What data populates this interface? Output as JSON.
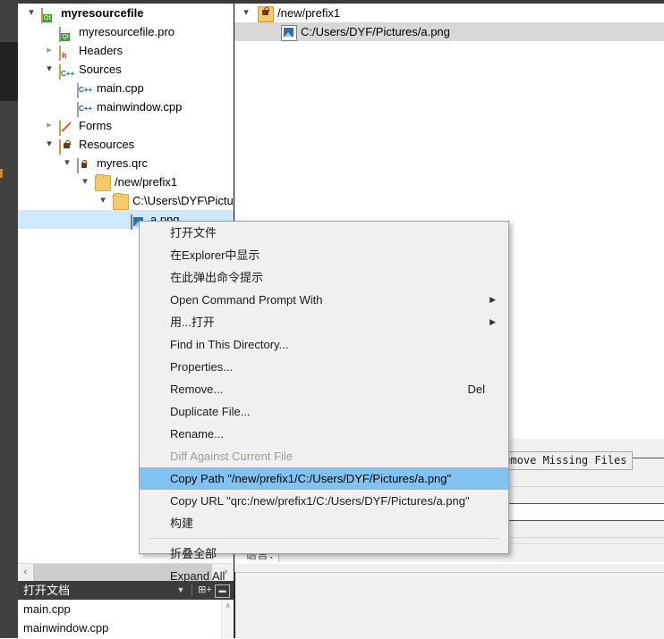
{
  "project_tree": {
    "panel_name": "project-tree",
    "rows": [
      {
        "depth": 0,
        "twisty": "open",
        "icon": "qt-project-icon",
        "icon_class": "ic-qtproj",
        "label": "myresourcefile",
        "bold": true,
        "selected": false
      },
      {
        "depth": 1,
        "twisty": "none",
        "icon": "qt-pro-file-icon",
        "icon_class": "ic-file",
        "label": "myresourcefile.pro",
        "bold": false,
        "selected": false
      },
      {
        "depth": 1,
        "twisty": "closed",
        "icon": "headers-folder-icon",
        "icon_class": "ic-hdr",
        "label": "Headers",
        "bold": false,
        "selected": false
      },
      {
        "depth": 1,
        "twisty": "open",
        "icon": "sources-folder-icon",
        "icon_class": "ic-src",
        "label": "Sources",
        "bold": false,
        "selected": false
      },
      {
        "depth": 2,
        "twisty": "none",
        "icon": "cpp-file-icon",
        "icon_class": "ic-cpp",
        "label": "main.cpp",
        "bold": false,
        "selected": false
      },
      {
        "depth": 2,
        "twisty": "none",
        "icon": "cpp-file-icon",
        "icon_class": "ic-cpp",
        "label": "mainwindow.cpp",
        "bold": false,
        "selected": false
      },
      {
        "depth": 1,
        "twisty": "closed",
        "icon": "forms-folder-icon",
        "icon_class": "ic-forms",
        "label": "Forms",
        "bold": false,
        "selected": false
      },
      {
        "depth": 1,
        "twisty": "open",
        "icon": "resources-folder-icon",
        "icon_class": "ic-res",
        "label": "Resources",
        "bold": false,
        "selected": false
      },
      {
        "depth": 2,
        "twisty": "open",
        "icon": "qrc-file-icon",
        "icon_class": "ic-qrc",
        "label": "myres.qrc",
        "bold": false,
        "selected": false
      },
      {
        "depth": 3,
        "twisty": "open",
        "icon": "folder-icon",
        "icon_class": "ic-folder",
        "label": "/new/prefix1",
        "bold": false,
        "selected": false
      },
      {
        "depth": 4,
        "twisty": "open",
        "icon": "folder-icon",
        "icon_class": "ic-folder",
        "label": "C:\\Users\\DYF\\Pictures",
        "bold": false,
        "selected": false
      },
      {
        "depth": 5,
        "twisty": "none",
        "icon": "png-image-icon",
        "icon_class": "ic-png",
        "label": "a.png",
        "bold": false,
        "selected": true
      }
    ]
  },
  "tree_scrollbar": {
    "left_arrow": "‹",
    "right_arrow": "›"
  },
  "open_documents": {
    "title": "打开文档",
    "caret_icon": "chevron-down-icon",
    "split_icon": "split-view-icon",
    "close_icon": "close-pane-icon",
    "items": [
      {
        "label": "main.cpp"
      },
      {
        "label": "mainwindow.cpp"
      }
    ],
    "scroll_up_arrow": "∧"
  },
  "qrc_editor": {
    "rows": [
      {
        "depth": 0,
        "twisty": "open",
        "icon": "qrc-prefix-icon",
        "label": "/new/prefix1",
        "selected": false
      },
      {
        "depth": 1,
        "twisty": "none",
        "icon": "png-image-icon",
        "label": "C:/Users/DYF/Pictures/a.png",
        "selected": true
      }
    ],
    "remove_missing_button": "Remove Missing Files",
    "language_label": "语言：",
    "language_value": ""
  },
  "context_menu": {
    "name": "file-context-menu",
    "items": [
      {
        "label": "打开文件",
        "accel": "",
        "submenu": false,
        "disabled": false,
        "highlighted": false,
        "separator": false,
        "name": "menu-item-open-file"
      },
      {
        "label": "在Explorer中显示",
        "accel": "",
        "submenu": false,
        "disabled": false,
        "highlighted": false,
        "separator": false,
        "name": "menu-item-show-in-explorer"
      },
      {
        "label": "在此弹出命令提示",
        "accel": "",
        "submenu": false,
        "disabled": false,
        "highlighted": false,
        "separator": false,
        "name": "menu-item-open-terminal-here"
      },
      {
        "label": "Open Command Prompt With",
        "accel": "",
        "submenu": true,
        "disabled": false,
        "highlighted": false,
        "separator": false,
        "name": "menu-item-open-command-prompt-with"
      },
      {
        "label": "用...打开",
        "accel": "",
        "submenu": true,
        "disabled": false,
        "highlighted": false,
        "separator": false,
        "name": "menu-item-open-with"
      },
      {
        "label": "Find in This Directory...",
        "accel": "",
        "submenu": false,
        "disabled": false,
        "highlighted": false,
        "separator": false,
        "name": "menu-item-find-in-this-directory"
      },
      {
        "label": "Properties...",
        "accel": "",
        "submenu": false,
        "disabled": false,
        "highlighted": false,
        "separator": false,
        "name": "menu-item-properties"
      },
      {
        "label": "Remove...",
        "accel": "Del",
        "submenu": false,
        "disabled": false,
        "highlighted": false,
        "separator": false,
        "name": "menu-item-remove"
      },
      {
        "label": "Duplicate File...",
        "accel": "",
        "submenu": false,
        "disabled": false,
        "highlighted": false,
        "separator": false,
        "name": "menu-item-duplicate-file"
      },
      {
        "label": "Rename...",
        "accel": "",
        "submenu": false,
        "disabled": false,
        "highlighted": false,
        "separator": false,
        "name": "menu-item-rename"
      },
      {
        "label": "Diff Against Current File",
        "accel": "",
        "submenu": false,
        "disabled": true,
        "highlighted": false,
        "separator": false,
        "name": "menu-item-diff-against-current-file"
      },
      {
        "label": "Copy Path \"/new/prefix1/C:/Users/DYF/Pictures/a.png\"",
        "accel": "",
        "submenu": false,
        "disabled": false,
        "highlighted": true,
        "separator": false,
        "name": "menu-item-copy-path"
      },
      {
        "label": "Copy URL \"qrc:/new/prefix1/C:/Users/DYF/Pictures/a.png\"",
        "accel": "",
        "submenu": false,
        "disabled": false,
        "highlighted": false,
        "separator": false,
        "name": "menu-item-copy-url"
      },
      {
        "label": "构建",
        "accel": "",
        "submenu": false,
        "disabled": false,
        "highlighted": false,
        "separator": false,
        "name": "menu-item-build"
      },
      {
        "label": "",
        "accel": "",
        "submenu": false,
        "disabled": false,
        "highlighted": false,
        "separator": true,
        "name": "menu-separator"
      },
      {
        "label": "折叠全部",
        "accel": "",
        "submenu": false,
        "disabled": false,
        "highlighted": false,
        "separator": false,
        "name": "menu-item-collapse-all"
      },
      {
        "label": "Expand All",
        "accel": "",
        "submenu": false,
        "disabled": false,
        "highlighted": false,
        "separator": false,
        "name": "menu-item-expand-all"
      }
    ]
  },
  "colors": {
    "highlight_blue": "#81c2f0",
    "tree_selection": "#cde8ff",
    "qrc_selection": "#d8d8d8",
    "menu_bg": "#f0f0f0",
    "activity_bar": "#414141",
    "panel_header": "#3c3c3c"
  }
}
